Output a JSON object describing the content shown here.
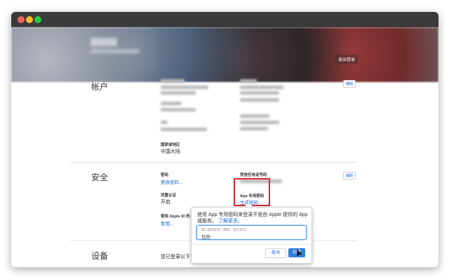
{
  "banner": {
    "signout_label": "退出登录"
  },
  "account": {
    "title": "帐户",
    "edit_label": "编辑",
    "country_label": "国家或地区",
    "country_value": "中国大陆"
  },
  "security": {
    "title": "安全",
    "edit_label": "编辑",
    "password_label": "密码",
    "change_password_link": "更改密码...",
    "trusted_phone_label": "受信任电话号码",
    "twofa_label": "双重认证",
    "twofa_value": "开启",
    "app_password_label": "App 专用密码",
    "generate_password_link": "生成密码...",
    "apple_id_label": "使用 Apple ID 的",
    "manage_link": "管理..."
  },
  "popup": {
    "description": "使用 App 专用密码来登录不是由 Apple 提供的 App 或服务。",
    "learn_more": "了解更多。",
    "input_placeholder": "输入密码标签（例如，电子支付）",
    "input_value": "日历",
    "cancel_label": "取消",
    "create_label": "创建"
  },
  "devices": {
    "title": "设备",
    "description": "您已登录以下设"
  }
}
